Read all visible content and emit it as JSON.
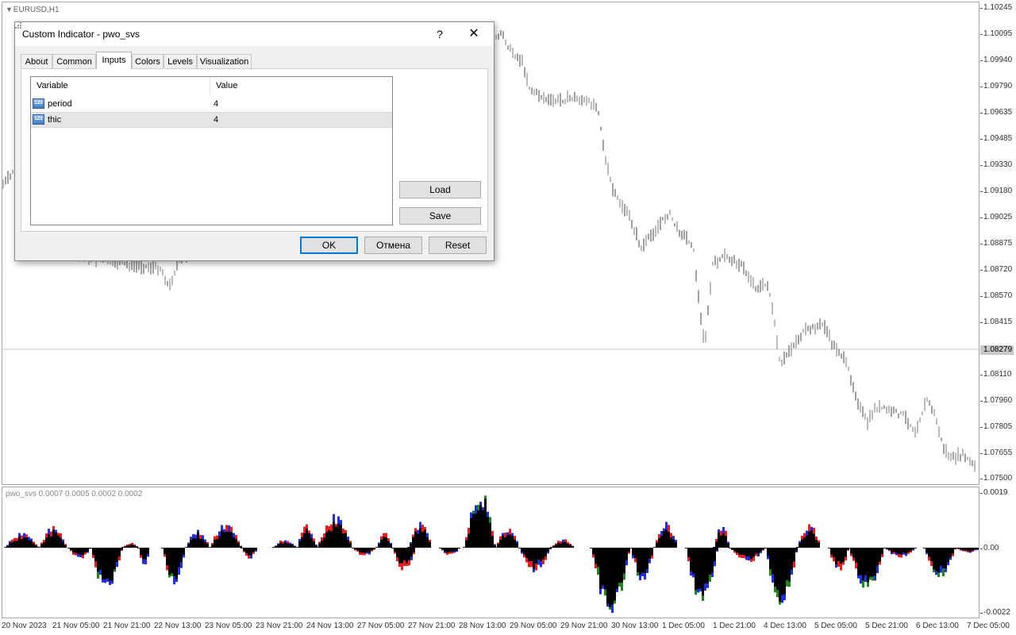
{
  "chart": {
    "symbol_title": "EURUSD,H1",
    "price_ticks": [
      "1.10245",
      "1.10095",
      "1.09940",
      "1.09790",
      "1.09635",
      "1.09485",
      "1.09330",
      "1.09180",
      "1.09025",
      "1.08875",
      "1.08720",
      "1.08570",
      "1.08415",
      "1.08110",
      "1.07960",
      "1.07805",
      "1.07655",
      "1.07500"
    ],
    "current_price": "1.08279",
    "time_labels": [
      "20 Nov 2023",
      "21 Nov 05:00",
      "21 Nov 21:00",
      "22 Nov 13:00",
      "23 Nov 05:00",
      "23 Nov 21:00",
      "24 Nov 13:00",
      "27 Nov 05:00",
      "27 Nov 21:00",
      "28 Nov 13:00",
      "29 Nov 05:00",
      "29 Nov 21:00",
      "30 Nov 13:00",
      "1 Dec 05:00",
      "1 Dec 21:00",
      "4 Dec 13:00",
      "5 Dec 05:00",
      "5 Dec 21:00",
      "6 Dec 13:00",
      "7 Dec 05:00"
    ]
  },
  "indicator": {
    "title": "pwo_svs 0.0007 0.0005 0.0002 0.0002",
    "scale": [
      "0.0019",
      "0.00",
      "-0.0022"
    ],
    "colors": {
      "up_strong": "#1a8a1a",
      "up_mid": "#1f2ee0",
      "low": "#ee1c1c",
      "base": "#000000"
    }
  },
  "dialog": {
    "title": "Custom Indicator - pwo_svs",
    "help_label": "?",
    "close_label": "✕",
    "tabs": [
      "About",
      "Common",
      "Inputs",
      "Colors",
      "Levels",
      "Visualization"
    ],
    "active_tab": "Inputs",
    "columns": [
      "Variable",
      "Value"
    ],
    "rows": [
      {
        "variable": "period",
        "value": "4",
        "icon": "123"
      },
      {
        "variable": "thic",
        "value": "4",
        "icon": "123"
      }
    ],
    "buttons": {
      "load": "Load",
      "save": "Save",
      "ok": "OK",
      "cancel": "Отмена",
      "reset": "Reset"
    }
  }
}
